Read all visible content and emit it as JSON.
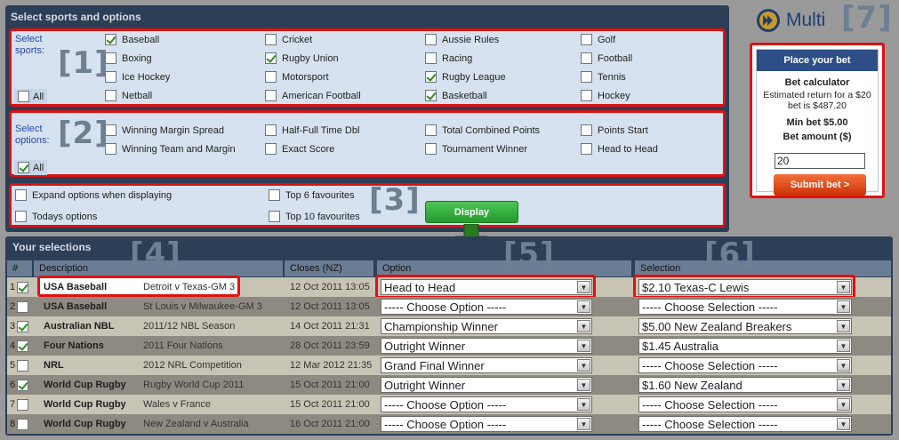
{
  "top_panel": {
    "title": "Select sports and options",
    "section1_number": "[1]",
    "section2_number": "[2]",
    "section3_number": "[3]",
    "sports_label": "Select sports:",
    "options_label": "Select options:",
    "all_label": "All",
    "sports": [
      {
        "label": "Baseball",
        "checked": true
      },
      {
        "label": "Cricket",
        "checked": false
      },
      {
        "label": "Aussie Rules",
        "checked": false
      },
      {
        "label": "Golf",
        "checked": false
      },
      {
        "label": "Boxing",
        "checked": false
      },
      {
        "label": "Rugby Union",
        "checked": true
      },
      {
        "label": "Racing",
        "checked": false
      },
      {
        "label": "Football",
        "checked": false
      },
      {
        "label": "Ice Hockey",
        "checked": false
      },
      {
        "label": "Motorsport",
        "checked": false
      },
      {
        "label": "Rugby League",
        "checked": true
      },
      {
        "label": "Tennis",
        "checked": false
      },
      {
        "label": "Netball",
        "checked": false
      },
      {
        "label": "American Football",
        "checked": false
      },
      {
        "label": "Basketball",
        "checked": true
      },
      {
        "label": "Hockey",
        "checked": false
      }
    ],
    "options": [
      {
        "label": "Winning Margin Spread",
        "checked": false
      },
      {
        "label": "Half-Full Time Dbl",
        "checked": false
      },
      {
        "label": "Total Combined Points",
        "checked": false
      },
      {
        "label": "Points Start",
        "checked": false
      },
      {
        "label": "Winning Team and Margin",
        "checked": false
      },
      {
        "label": "Exact Score",
        "checked": false
      },
      {
        "label": "Tournament Winner",
        "checked": false
      },
      {
        "label": "Head to Head",
        "checked": false
      }
    ],
    "display_opts": [
      {
        "label": "Expand options when displaying",
        "checked": false
      },
      {
        "label": "Todays options",
        "checked": false
      },
      {
        "label": "Top 6 favourites",
        "checked": false
      },
      {
        "label": "Top 10 favourites",
        "checked": false
      }
    ],
    "display_button": "Display"
  },
  "bet": {
    "multi_label": "Multi",
    "number": "[7]",
    "title": "Place your bet",
    "calc_label": "Bet calculator",
    "estimate_line1": "Estimated return for a $20",
    "estimate_line2": "bet is $487.20",
    "min_bet": "Min bet $5.00",
    "amount_label": "Bet amount ($)",
    "amount_value": "20",
    "submit_label": "Submit bet >"
  },
  "selections": {
    "title": "Your selections",
    "num4": "[4]",
    "num5": "[5]",
    "num6": "[6]",
    "headers": {
      "num": "#",
      "description": "Description",
      "closes": "Closes (NZ)",
      "option": "Option",
      "selection": "Selection"
    },
    "rows": [
      {
        "num": "1",
        "checked": true,
        "sport": "USA Baseball",
        "event": "Detroit v Texas-GM 3",
        "closes": "12 Oct 2011 13:05",
        "option": "Head to Head",
        "selection": "$2.10 Texas-C Lewis"
      },
      {
        "num": "2",
        "checked": false,
        "sport": "USA Baseball",
        "event": "St Louis v Milwaukee-GM 3",
        "closes": "12 Oct 2011 13:05",
        "option": "----- Choose Option -----",
        "selection": "----- Choose Selection -----"
      },
      {
        "num": "3",
        "checked": true,
        "sport": "Australian NBL",
        "event": "2011/12 NBL Season",
        "closes": "14 Oct 2011 21:31",
        "option": "Championship Winner",
        "selection": "$5.00 New Zealand Breakers"
      },
      {
        "num": "4",
        "checked": true,
        "sport": "Four Nations",
        "event": "2011 Four Nations",
        "closes": "28 Oct 2011 23:59",
        "option": "Outright Winner",
        "selection": "$1.45 Australia"
      },
      {
        "num": "5",
        "checked": false,
        "sport": "NRL",
        "event": "2012 NRL Competition",
        "closes": "12 Mar 2012 21:35",
        "option": "Grand Final Winner",
        "selection": "----- Choose Selection -----"
      },
      {
        "num": "6",
        "checked": true,
        "sport": "World Cup Rugby",
        "event": "Rugby World Cup 2011",
        "closes": "15 Oct 2011 21:00",
        "option": "Outright Winner",
        "selection": "$1.60 New Zealand"
      },
      {
        "num": "7",
        "checked": false,
        "sport": "World Cup Rugby",
        "event": "Wales v France",
        "closes": "15 Oct 2011 21:00",
        "option": "----- Choose Option -----",
        "selection": "----- Choose Selection -----"
      },
      {
        "num": "8",
        "checked": false,
        "sport": "World Cup Rugby",
        "event": "New Zealand v Australia",
        "closes": "16 Oct 2011 21:00",
        "option": "----- Choose Option -----",
        "selection": "----- Choose Selection -----"
      }
    ]
  }
}
